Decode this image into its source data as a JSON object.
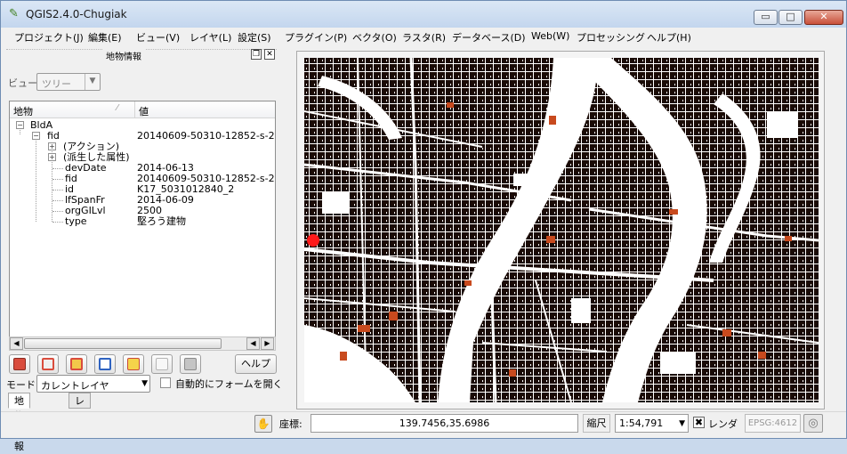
{
  "window": {
    "title": "QGIS2.4.0-Chugiak",
    "minimize": "▭",
    "maximize": "□",
    "close": "✕"
  },
  "menu": [
    "プロジェクト(J)",
    "編集(E)",
    "ビュー(V)",
    "レイヤ(L)",
    "設定(S)",
    "プラグイン(P)",
    "ベクタ(O)",
    "ラスタ(R)",
    "データベース(D)",
    "Web(W)",
    "プロセッシング",
    "ヘルプ(H)"
  ],
  "panel": {
    "title": "地物情報",
    "float_icon": "restore-icon",
    "close_icon": "close-icon",
    "view_label": "ビュー",
    "view_value": "ツリー",
    "columns": {
      "feature": "地物",
      "value": "値"
    },
    "tree": {
      "layer": "BldA",
      "feature_key": "fid",
      "feature_value": "20140609-50310-12852-s-214",
      "actions": "(アクション)",
      "derived": "(派生した属性)",
      "attributes": [
        {
          "name": "devDate",
          "value": "2014-06-13"
        },
        {
          "name": "fid",
          "value": "20140609-50310-12852-s-214"
        },
        {
          "name": "id",
          "value": "K17_5031012840_2"
        },
        {
          "name": "lfSpanFr",
          "value": "2014-06-09"
        },
        {
          "name": "orgGILvl",
          "value": "2500"
        },
        {
          "name": "type",
          "value": "堅ろう建物"
        }
      ]
    },
    "help_button": "ヘルプ",
    "mode_label": "モード",
    "mode_value": "カレントレイヤ",
    "auto_form_label": "自動的にフォームを開く",
    "tabs": [
      "地物情報",
      "レイヤ"
    ]
  },
  "status": {
    "coord_label": "座標:",
    "coord_value": "139.7456,35.6986",
    "scale_label": "縮尺",
    "scale_value": "1:54,791",
    "render_label": "レンダ",
    "render_check": "✖",
    "crs": "EPSG:4612"
  },
  "map": {
    "background": "#ffffff",
    "building_color": "#1a0b06",
    "highlight_color": "#c84a1e",
    "marker_color": "#ff1a1a"
  }
}
